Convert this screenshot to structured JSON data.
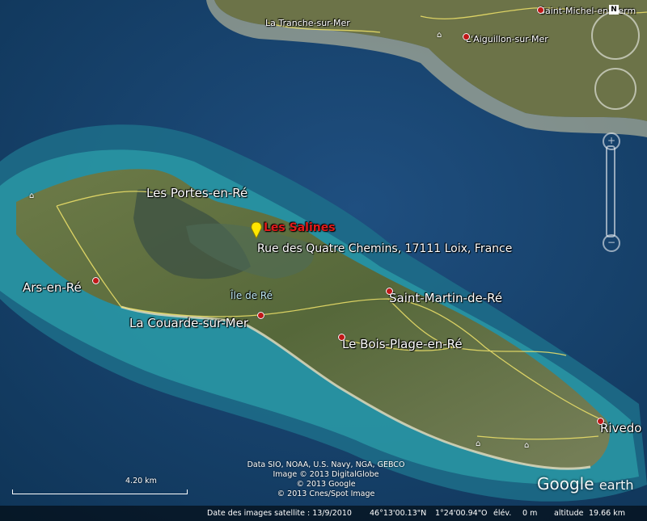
{
  "places": {
    "la_tranche": "La Tranche-sur-Mer",
    "saint_michel": "Saint-Michel-en-Herm",
    "aiguillon": "L'Aiguillon-sur-Mer",
    "portes": "Les Portes-en-Ré",
    "ars": "Ars-en-Ré",
    "ile_de_re": "Île de Ré",
    "couarde": "La Couarde-sur-Mer",
    "saint_martin": "Saint-Martin-de-Ré",
    "bois_plage": "Le Bois-Plage-en-Ré",
    "rivedoux": "Rivedo"
  },
  "poi": {
    "name": "Les Salines",
    "address": "Rue des Quatre Chemins, 17111 Loix, France",
    "marker_color": "#ffe600"
  },
  "credits": {
    "line1": "Data SIO, NOAA, U.S. Navy, NGA, GEBCO",
    "line2": "Image © 2013 DigitalGlobe",
    "line3": "© 2013 Google",
    "line4": "© 2013 Cnes/Spot Image"
  },
  "scale": {
    "label": "4.20 km"
  },
  "logo": {
    "google": "Google",
    "earth": "earth"
  },
  "status": {
    "imagery_date": "Date des images satellite : 13/9/2010",
    "lat": "46°13'00.13\"N",
    "lon": "1°24'00.94\"O",
    "elev_label": "élév.",
    "elev_value": "0 m",
    "alt_label": "altitude",
    "alt_value": "19.66 km"
  },
  "nav": {
    "north": "N",
    "zoom_in": "+",
    "zoom_out": "−"
  },
  "colors": {
    "sea_deep": "#123e63",
    "sea_shallow": "#1f8a9a",
    "land": "#5e6e3f",
    "roads": "#f0e36a"
  },
  "icons": [
    "compass-ring-icon",
    "placemark-pin-icon",
    "town-dot-icon",
    "landmark-icon"
  ]
}
